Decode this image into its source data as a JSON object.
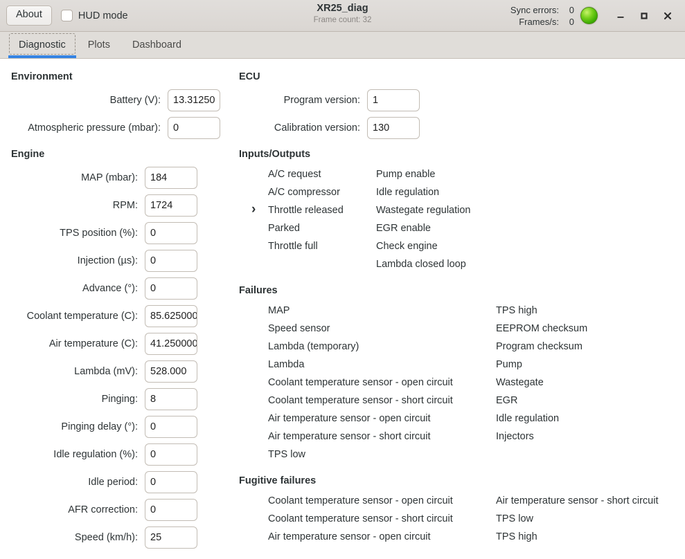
{
  "header": {
    "about_label": "About",
    "hud_label": "HUD mode",
    "hud_checked": false,
    "title": "XR25_diag",
    "subtitle": "Frame count: 32",
    "sync_errors_label": "Sync errors:",
    "sync_errors_value": "0",
    "frames_label": "Frames/s:",
    "frames_value": "0",
    "led_color": "#76d01c",
    "minimize_label": "Minimize",
    "maximize_label": "Maximize",
    "close_label": "Close"
  },
  "tabs": [
    {
      "label": "Diagnostic",
      "active": true
    },
    {
      "label": "Plots",
      "active": false
    },
    {
      "label": "Dashboard",
      "active": false
    }
  ],
  "accent_color": "#3584e4",
  "environment": {
    "title": "Environment",
    "fields": [
      {
        "label": "Battery (V):",
        "value": "13.31250"
      },
      {
        "label": "Atmospheric pressure (mbar):",
        "value": "0"
      }
    ]
  },
  "ecu": {
    "title": "ECU",
    "fields": [
      {
        "label": "Program version:",
        "value": "1"
      },
      {
        "label": "Calibration version:",
        "value": "130"
      }
    ]
  },
  "engine": {
    "title": "Engine",
    "fields": [
      {
        "label": "MAP (mbar):",
        "value": "184"
      },
      {
        "label": "RPM:",
        "value": "1724"
      },
      {
        "label": "TPS position (%):",
        "value": "0"
      },
      {
        "label": "Injection (µs):",
        "value": "0"
      },
      {
        "label": "Advance (°):",
        "value": "0"
      },
      {
        "label": "Coolant temperature (C):",
        "value": "85.625000"
      },
      {
        "label": "Air temperature (C):",
        "value": "41.250000"
      },
      {
        "label": "Lambda (mV):",
        "value": "528.000"
      },
      {
        "label": "Pinging:",
        "value": "8"
      },
      {
        "label": "Pinging delay (°):",
        "value": "0"
      },
      {
        "label": "Idle regulation (%):",
        "value": "0"
      },
      {
        "label": "Idle period:",
        "value": "0"
      },
      {
        "label": "AFR correction:",
        "value": "0"
      },
      {
        "label": "Speed (km/h):",
        "value": "25"
      }
    ]
  },
  "inputs_outputs": {
    "title": "Inputs/Outputs",
    "col1": [
      {
        "label": "A/C request",
        "marked": false
      },
      {
        "label": "A/C compressor",
        "marked": false
      },
      {
        "label": "Throttle released",
        "marked": true
      },
      {
        "label": "Parked",
        "marked": false
      },
      {
        "label": "Throttle full",
        "marked": false
      }
    ],
    "col2": [
      {
        "label": "Pump enable",
        "marked": false
      },
      {
        "label": "Idle regulation",
        "marked": false
      },
      {
        "label": "Wastegate regulation",
        "marked": false
      },
      {
        "label": "EGR enable",
        "marked": false
      },
      {
        "label": "Check engine",
        "marked": false
      },
      {
        "label": "Lambda closed loop",
        "marked": false
      }
    ]
  },
  "failures": {
    "title": "Failures",
    "col1": [
      {
        "label": "MAP",
        "marked": false
      },
      {
        "label": "Speed sensor",
        "marked": false
      },
      {
        "label": "Lambda (temporary)",
        "marked": false
      },
      {
        "label": "Lambda",
        "marked": false
      },
      {
        "label": "Coolant temperature sensor - open circuit",
        "marked": false
      },
      {
        "label": "Coolant temperature sensor - short circuit",
        "marked": false
      },
      {
        "label": "Air temperature sensor - open circuit",
        "marked": false
      },
      {
        "label": "Air temperature sensor - short circuit",
        "marked": false
      },
      {
        "label": "TPS low",
        "marked": false
      }
    ],
    "col2": [
      {
        "label": "TPS high",
        "marked": false
      },
      {
        "label": "EEPROM checksum",
        "marked": false
      },
      {
        "label": "Program checksum",
        "marked": false
      },
      {
        "label": "Pump",
        "marked": false
      },
      {
        "label": "Wastegate",
        "marked": false
      },
      {
        "label": "EGR",
        "marked": false
      },
      {
        "label": "Idle regulation",
        "marked": false
      },
      {
        "label": "Injectors",
        "marked": false
      }
    ]
  },
  "fugitive_failures": {
    "title": "Fugitive failures",
    "col1": [
      {
        "label": "Coolant temperature sensor - open circuit",
        "marked": false
      },
      {
        "label": "Coolant temperature sensor - short circuit",
        "marked": false
      },
      {
        "label": "Air temperature sensor - open circuit",
        "marked": false
      }
    ],
    "col2": [
      {
        "label": "Air temperature sensor - short circuit",
        "marked": false
      },
      {
        "label": "TPS low",
        "marked": false
      },
      {
        "label": "TPS high",
        "marked": false
      }
    ]
  }
}
